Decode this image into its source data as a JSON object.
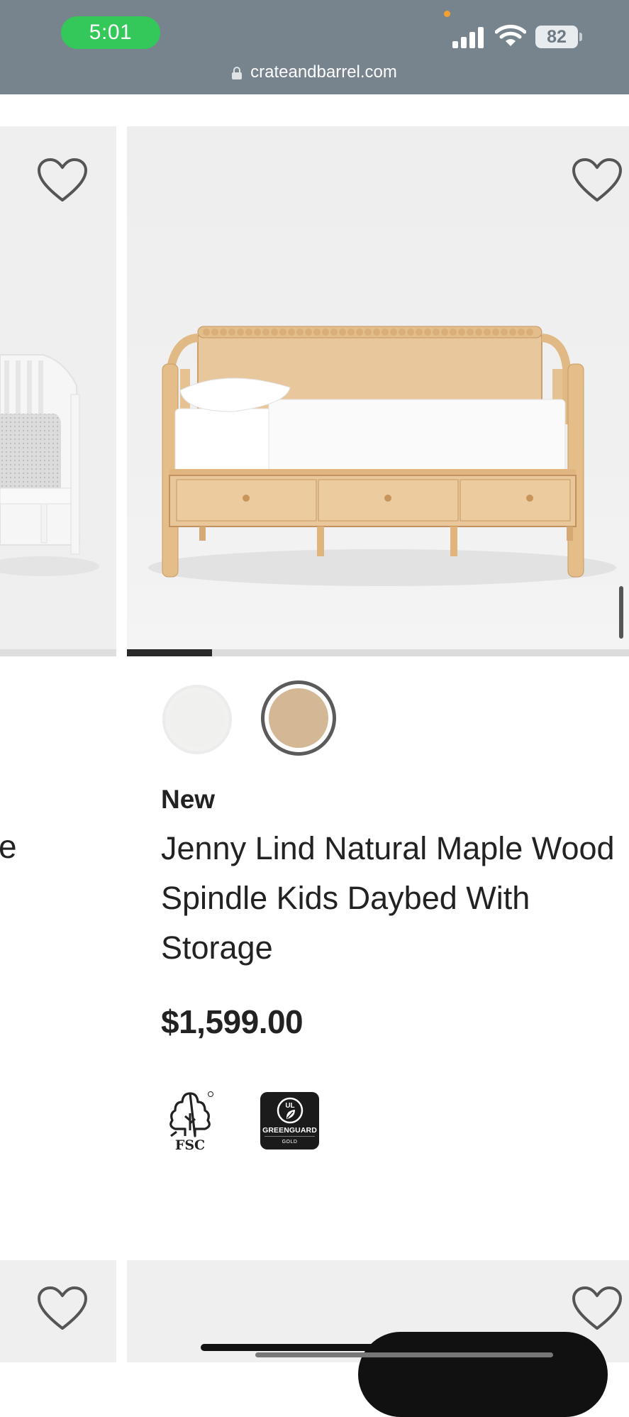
{
  "status_bar": {
    "time": "5:01",
    "battery": "82",
    "url": "crateandbarrel.com"
  },
  "colors": {
    "status_bar_bg": "#77848d",
    "time_pill": "#34c759",
    "swatch_white": "#f0f0ee",
    "swatch_maple": "#d4b896"
  },
  "product": {
    "badge": "New",
    "title": "Jenny Lind Natural Maple Wood Spindle Kids Daybed With Storage",
    "price": "$1,599.00",
    "image_progress": 0.17,
    "swatches": [
      {
        "name": "white"
      },
      {
        "name": "natural-maple",
        "selected": true
      }
    ],
    "certifications": {
      "fsc": "FSC",
      "greenguard_mark": "UL",
      "greenguard": "GREENGUARD",
      "greenguard_tier": "GOLD"
    }
  },
  "left_card": {
    "partial_title": "e"
  }
}
